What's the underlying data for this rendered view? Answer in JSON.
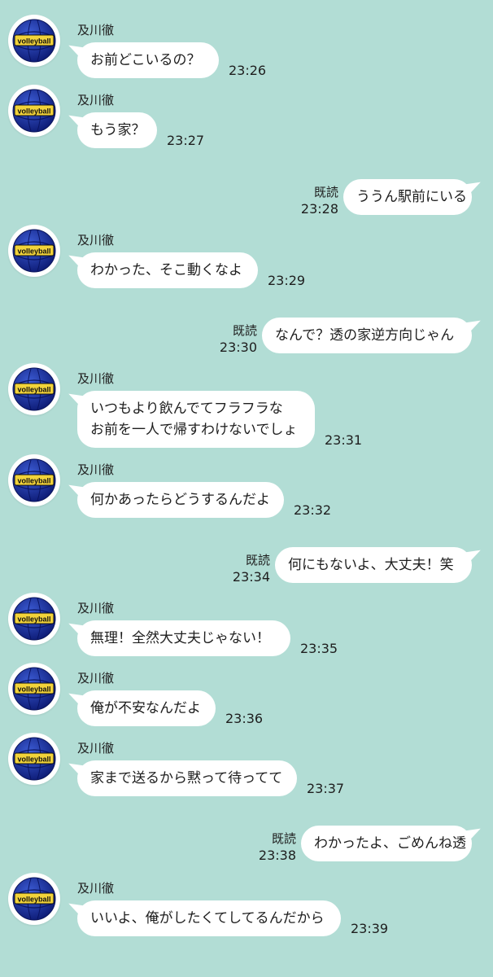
{
  "colors": {
    "background": "#b2ddd5",
    "bubble": "#ffffff",
    "text": "#1e1e1e"
  },
  "contact": {
    "name": "及川徹",
    "avatar_text": "volleyball"
  },
  "read_label": "既読",
  "messages": [
    {
      "dir": "in",
      "text": "お前どこいるの？",
      "time": "23:26"
    },
    {
      "dir": "in",
      "text": "もう家？",
      "time": "23:27"
    },
    {
      "dir": "out",
      "text": "ううん駅前にいる",
      "time": "23:28"
    },
    {
      "dir": "in",
      "text": "わかった、そこ動くなよ",
      "time": "23:29"
    },
    {
      "dir": "out",
      "text": "なんで？透の家逆方向じゃん",
      "time": "23:30"
    },
    {
      "dir": "in",
      "text": "いつもより飲んでてフラフラな\nお前を一人で帰すわけないでしょ",
      "time": "23:31"
    },
    {
      "dir": "in",
      "text": "何かあったらどうするんだよ",
      "time": "23:32"
    },
    {
      "dir": "out",
      "text": "何にもないよ、大丈夫！笑",
      "time": "23:34"
    },
    {
      "dir": "in",
      "text": "無理！全然大丈夫じゃない！",
      "time": "23:35"
    },
    {
      "dir": "in",
      "text": "俺が不安なんだよ",
      "time": "23:36"
    },
    {
      "dir": "in",
      "text": "家まで送るから黙って待ってて",
      "time": "23:37"
    },
    {
      "dir": "out",
      "text": "わかったよ、ごめんね透",
      "time": "23:38"
    },
    {
      "dir": "in",
      "text": "いいよ、俺がしたくてしてるんだから",
      "time": "23:39"
    }
  ]
}
